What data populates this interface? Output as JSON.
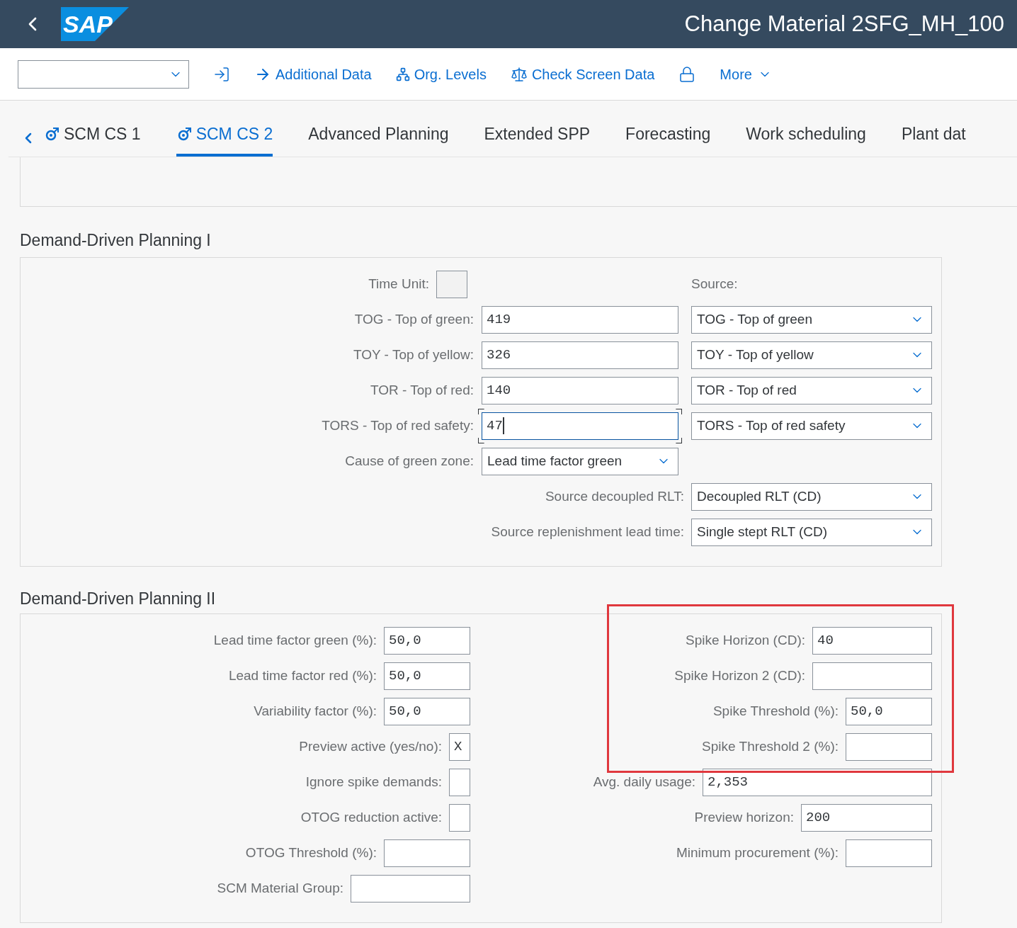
{
  "shell": {
    "logo": "SAP",
    "title": "Change Material 2SFG_MH_100"
  },
  "toolbar": {
    "items": [
      {
        "kind": "icon"
      },
      {
        "kind": "link",
        "label": "Additional Data"
      },
      {
        "kind": "link",
        "label": "Org. Levels"
      },
      {
        "kind": "link",
        "label": "Check Screen Data"
      },
      {
        "kind": "icon"
      },
      {
        "kind": "menu",
        "label": "More"
      }
    ]
  },
  "tabs": [
    {
      "kind": "object",
      "label": "SCM CS 1",
      "selected": false
    },
    {
      "kind": "object",
      "label": "SCM CS 2",
      "selected": true
    },
    {
      "kind": "plain",
      "label": "Advanced Planning",
      "selected": false
    },
    {
      "kind": "plain",
      "label": "Extended SPP",
      "selected": false
    },
    {
      "kind": "plain",
      "label": "Forecasting",
      "selected": false
    },
    {
      "kind": "plain",
      "label": "Work scheduling",
      "selected": false
    },
    {
      "kind": "plain",
      "label": "Plant dat",
      "selected": false
    }
  ],
  "ddp1": {
    "title": "Demand-Driven Planning I",
    "time_unit_label": "Time Unit:",
    "source_label": "Source:",
    "rows": [
      {
        "label": "TOG - Top of green:",
        "value": "419",
        "focused": false,
        "source": "TOG - Top of green"
      },
      {
        "label": "TOY - Top of yellow:",
        "value": "326",
        "focused": false,
        "source": "TOY - Top of yellow"
      },
      {
        "label": "TOR - Top of red:",
        "value": "140",
        "focused": false,
        "source": "TOR - Top of red"
      },
      {
        "label": "TORS - Top of red safety:",
        "value": "47",
        "focused": true,
        "source": "TORS - Top of red safety"
      }
    ],
    "cause": {
      "label": "Cause of green zone:",
      "value": "Lead time factor green"
    },
    "sources": [
      {
        "label": "Source decoupled RLT:",
        "value": "Decoupled RLT (CD)"
      },
      {
        "label": "Source replenishment lead time:",
        "value": "Single stept RLT (CD)"
      }
    ]
  },
  "ddp2": {
    "title": "Demand-Driven Planning II",
    "left": [
      {
        "kind": "number",
        "label": "Lead time factor green (%):",
        "value": "50,0"
      },
      {
        "kind": "number",
        "label": "Lead time factor red (%):",
        "value": "50,0"
      },
      {
        "kind": "number",
        "label": "Variability factor (%):",
        "value": "50,0"
      },
      {
        "kind": "flag",
        "label": "Preview active (yes/no):",
        "value": "X"
      },
      {
        "kind": "flag",
        "label": "Ignore spike demands:"
      },
      {
        "kind": "flag",
        "label": "OTOG reduction active:"
      },
      {
        "kind": "number",
        "label": "OTOG Threshold (%):"
      },
      {
        "kind": "wide",
        "label": "SCM Material Group:"
      }
    ],
    "right": [
      {
        "kind": "wide",
        "label": "Spike Horizon (CD):",
        "value": "40"
      },
      {
        "kind": "wide",
        "label": "Spike Horizon 2 (CD):"
      },
      {
        "kind": "number",
        "label": "Spike Threshold (%):",
        "value": "50,0"
      },
      {
        "kind": "number",
        "label": "Spike Threshold 2 (%):"
      },
      {
        "kind": "long",
        "label": "Avg. daily usage:",
        "value": "2,353"
      },
      {
        "kind": "medium",
        "label": "Preview horizon:",
        "value": "200"
      },
      {
        "kind": "number",
        "label": "Minimum procurement (%):"
      }
    ]
  }
}
